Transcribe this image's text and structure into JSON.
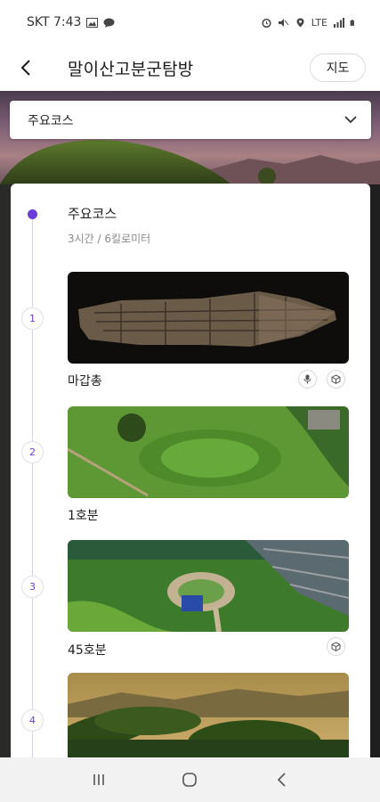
{
  "status_bar": {
    "carrier_time": "SKT 7:43",
    "network": "LTE",
    "icons": [
      "image-icon",
      "chat-icon",
      "alarm-icon",
      "mute-icon",
      "location-icon",
      "signal-icon",
      "battery-icon"
    ]
  },
  "header": {
    "title": "말이산고분군탐방",
    "map_label": "지도",
    "back_icon": "back-arrow-icon"
  },
  "course_selector": {
    "selected": "주요코스",
    "icon": "chevron-down-icon"
  },
  "course": {
    "title": "주요코스",
    "meta": "3시간 / 6킬로미터"
  },
  "spots": [
    {
      "number": "1",
      "name": "마갑총",
      "actions": [
        "microphone-icon",
        "3d-model-icon"
      ]
    },
    {
      "number": "2",
      "name": "1호분",
      "actions": []
    },
    {
      "number": "3",
      "name": "45호분",
      "actions": [
        "3d-model-icon"
      ]
    },
    {
      "number": "4",
      "name": "",
      "actions": []
    }
  ],
  "colors": {
    "accent": "#6c3ed9",
    "timeline": "#d9d4ea"
  },
  "nav_bar": {
    "icons": [
      "recent-apps-icon",
      "home-icon",
      "nav-back-icon"
    ]
  }
}
